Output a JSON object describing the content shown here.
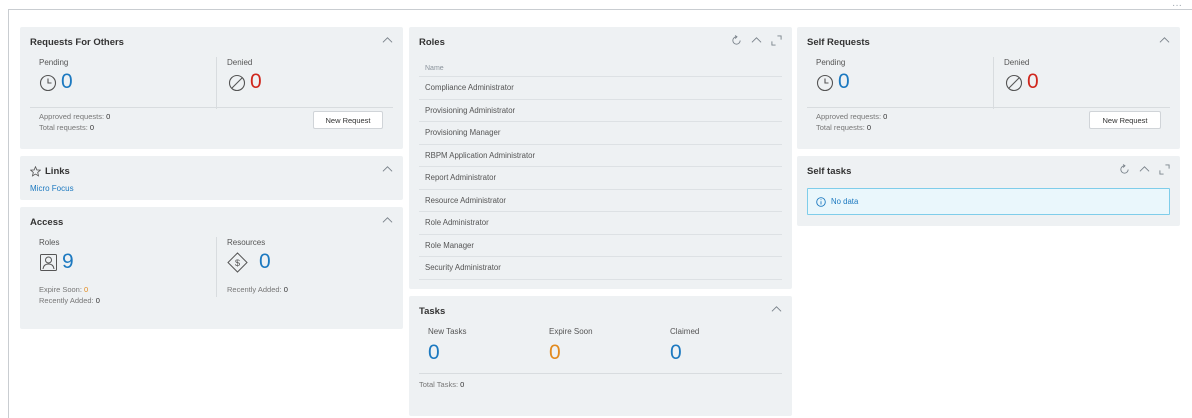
{
  "requests_for_others": {
    "title": "Requests For Others",
    "pending_label": "Pending",
    "pending_count": "0",
    "denied_label": "Denied",
    "denied_count": "0",
    "approved_label": "Approved requests:",
    "approved_value": "0",
    "total_label": "Total requests:",
    "total_value": "0",
    "new_request_label": "New Request"
  },
  "links": {
    "title": "Links",
    "items": [
      "Micro Focus"
    ]
  },
  "access": {
    "title": "Access",
    "roles_label": "Roles",
    "roles_count": "9",
    "resources_label": "Resources",
    "resources_count": "0",
    "expire_soon_label": "Expire Soon:",
    "expire_soon_value": "0",
    "recently_added_label": "Recently Added:",
    "recently_added_value": "0",
    "res_recently_added_label": "Recently Added:",
    "res_recently_added_value": "0"
  },
  "roles": {
    "title": "Roles",
    "column_header": "Name",
    "items": [
      "Compliance Administrator",
      "Provisioning Administrator",
      "Provisioning Manager",
      "RBPM Application Administrator",
      "Report Administrator",
      "Resource Administrator",
      "Role Administrator",
      "Role Manager",
      "Security Administrator"
    ]
  },
  "tasks": {
    "title": "Tasks",
    "new_tasks_label": "New Tasks",
    "new_tasks_count": "0",
    "expire_soon_label": "Expire Soon",
    "expire_soon_count": "0",
    "claimed_label": "Claimed",
    "claimed_count": "0",
    "total_label": "Total Tasks:",
    "total_value": "0"
  },
  "self_requests": {
    "title": "Self Requests",
    "pending_label": "Pending",
    "pending_count": "0",
    "denied_label": "Denied",
    "denied_count": "0",
    "approved_label": "Approved requests:",
    "approved_value": "0",
    "total_label": "Total requests:",
    "total_value": "0",
    "new_request_label": "New Request"
  },
  "self_tasks": {
    "title": "Self tasks",
    "no_data": "No data"
  },
  "page": {
    "more_dots": "···"
  },
  "colors": {
    "accent_blue": "#1c79c0",
    "denied_red": "#d0271d",
    "warning_orange": "#e28a1e",
    "card_bg": "#eef1f3"
  }
}
